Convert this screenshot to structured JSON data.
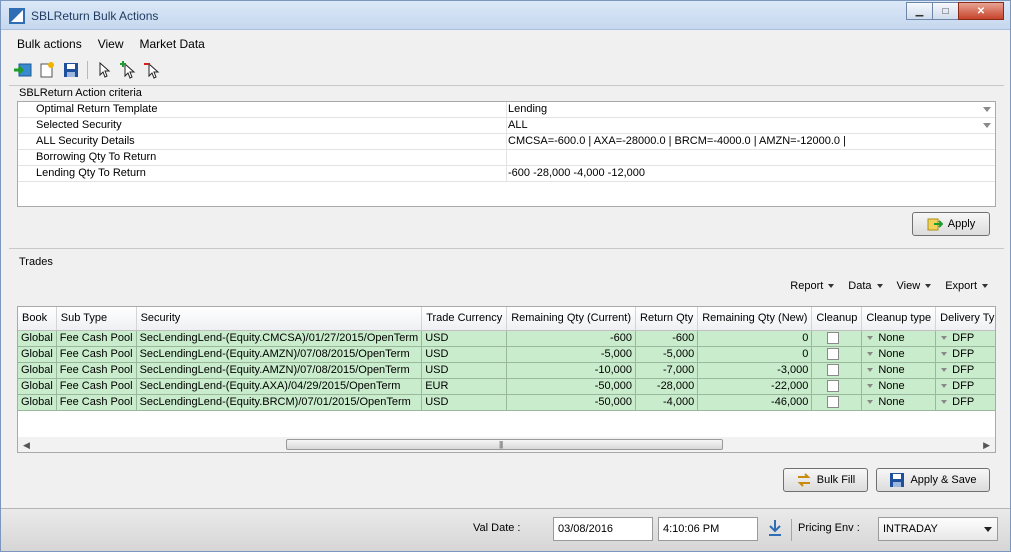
{
  "window": {
    "title": "SBLReturn Bulk Actions"
  },
  "menu": [
    "Bulk actions",
    "View",
    "Market Data"
  ],
  "criteria": {
    "section_label": "SBLReturn Action criteria",
    "rows": [
      {
        "label": "Optimal Return Template",
        "value": "Lending"
      },
      {
        "label": "Selected Security",
        "value": "ALL"
      },
      {
        "label": "ALL Security Details",
        "value": "CMCSA=-600.0 | AXA=-28000.0 | BRCM=-4000.0 | AMZN=-12000.0 |"
      },
      {
        "label": "Borrowing Qty To Return",
        "value": ""
      },
      {
        "label": "Lending Qty To Return",
        "value": "-600 -28,000 -4,000 -12,000"
      }
    ],
    "apply_label": "Apply"
  },
  "trades": {
    "section_label": "Trades",
    "tools": [
      "Report",
      "Data",
      "View",
      "Export"
    ],
    "columns": [
      "Book",
      "Sub Type",
      "Security",
      "Trade Currency",
      "Remaining Qty (Current)",
      "Return Qty",
      "Remaining Qty (New)",
      "Cleanup",
      "Cleanup type",
      "Delivery Ty"
    ],
    "rows": [
      {
        "book": "Global",
        "sub_type": "Fee Cash Pool",
        "security": "SecLendingLend-(Equity.CMCSA)/01/27/2015/OpenTerm",
        "currency": "USD",
        "rem_current": "-600",
        "return_qty": "-600",
        "rem_new": "0",
        "cleanup_type": "None",
        "delivery": "DFP"
      },
      {
        "book": "Global",
        "sub_type": "Fee Cash Pool",
        "security": "SecLendingLend-(Equity.AMZN)/07/08/2015/OpenTerm",
        "currency": "USD",
        "rem_current": "-5,000",
        "return_qty": "-5,000",
        "rem_new": "0",
        "cleanup_type": "None",
        "delivery": "DFP"
      },
      {
        "book": "Global",
        "sub_type": "Fee Cash Pool",
        "security": "SecLendingLend-(Equity.AMZN)/07/08/2015/OpenTerm",
        "currency": "USD",
        "rem_current": "-10,000",
        "return_qty": "-7,000",
        "rem_new": "-3,000",
        "cleanup_type": "None",
        "delivery": "DFP"
      },
      {
        "book": "Global",
        "sub_type": "Fee Cash Pool",
        "security": "SecLendingLend-(Equity.AXA)/04/29/2015/OpenTerm",
        "currency": "EUR",
        "rem_current": "-50,000",
        "return_qty": "-28,000",
        "rem_new": "-22,000",
        "cleanup_type": "None",
        "delivery": "DFP"
      },
      {
        "book": "Global",
        "sub_type": "Fee Cash Pool",
        "security": "SecLendingLend-(Equity.BRCM)/07/01/2015/OpenTerm",
        "currency": "USD",
        "rem_current": "-50,000",
        "return_qty": "-4,000",
        "rem_new": "-46,000",
        "cleanup_type": "None",
        "delivery": "DFP"
      }
    ],
    "bulk_fill_label": "Bulk Fill",
    "apply_save_label": "Apply & Save"
  },
  "status": {
    "val_date_label": "Val Date :",
    "val_date": "03/08/2016",
    "time": "4:10:06 PM",
    "pricing_env_label": "Pricing Env :",
    "pricing_env": "INTRADAY"
  },
  "colors": {
    "row_bg": "#c9eccc",
    "title_bg": "#c6d8ef"
  }
}
